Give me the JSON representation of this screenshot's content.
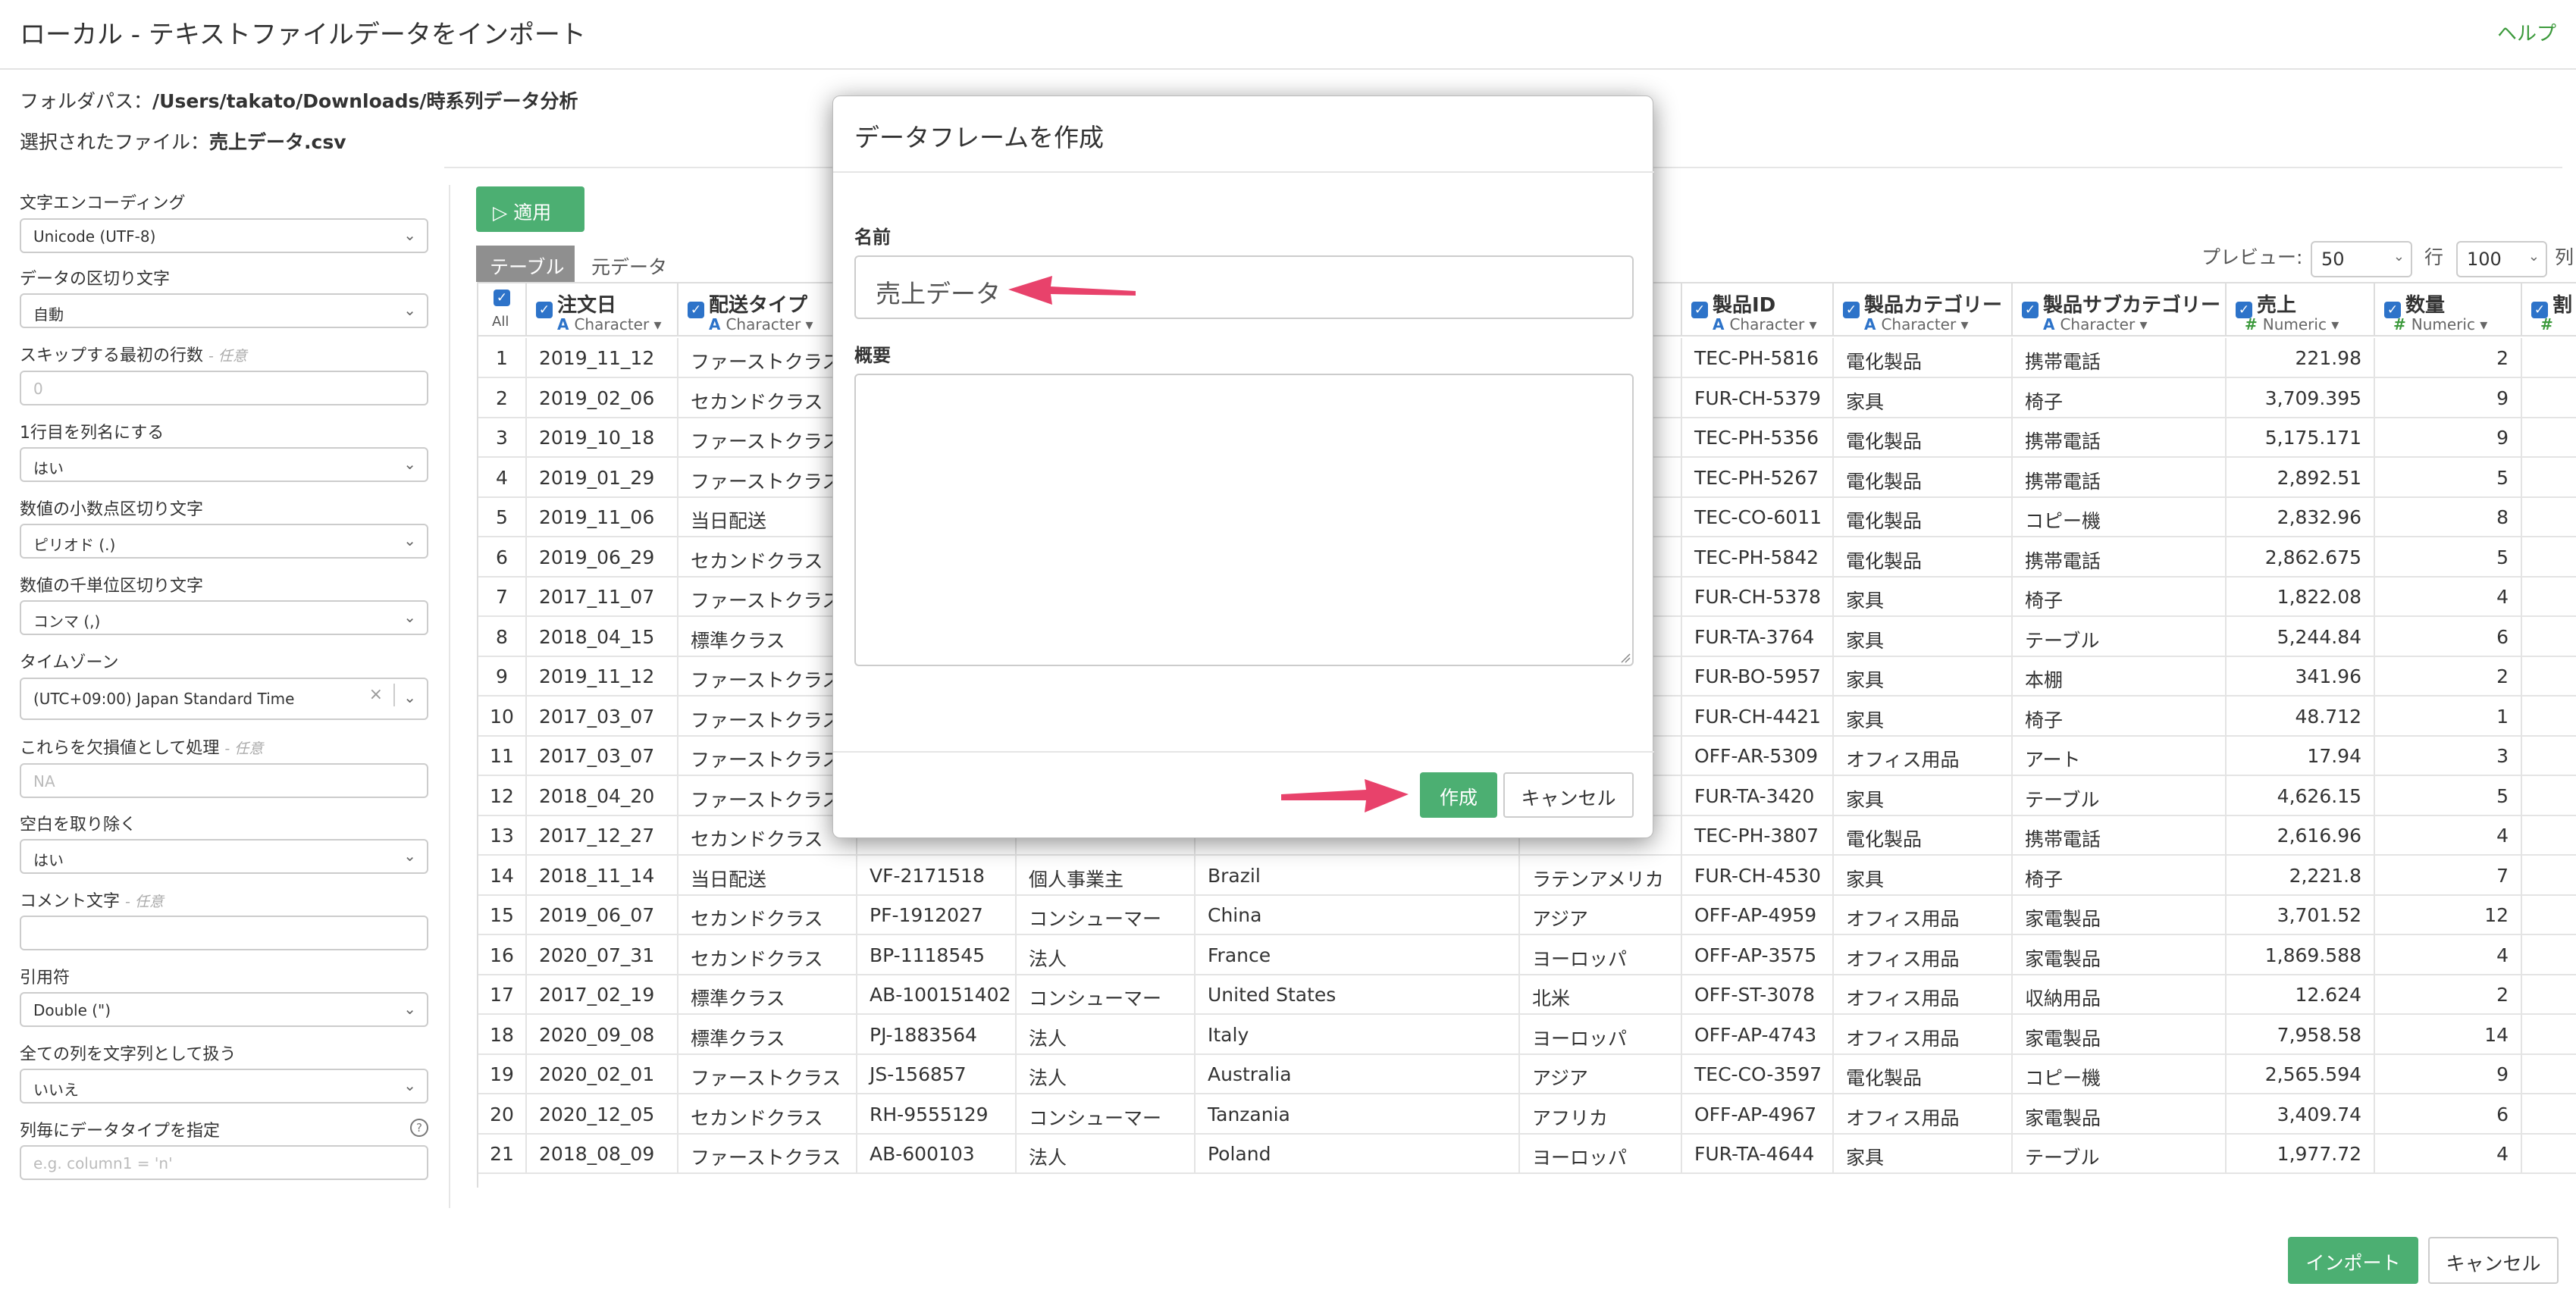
{
  "header": {
    "title": "ローカル - テキストファイルデータをインポート",
    "help": "ヘルプ"
  },
  "folder": {
    "label": "フォルダパス：",
    "value": "/Users/takato/Downloads/時系列データ分析"
  },
  "file": {
    "label": "選択されたファイル：",
    "value": "売上データ.csv"
  },
  "settings": {
    "encoding": {
      "label": "文字エンコーディング",
      "value": "Unicode (UTF-8)"
    },
    "delimiter": {
      "label": "データの区切り文字",
      "value": "自動"
    },
    "skip": {
      "label": "スキップする最初の行数",
      "optional": "- 任意",
      "placeholder": "0"
    },
    "header_row": {
      "label": "1行目を列名にする",
      "value": "はい"
    },
    "decimal": {
      "label": "数値の小数点区切り文字",
      "value": "ピリオド (.)"
    },
    "thousands": {
      "label": "数値の千単位区切り文字",
      "value": "コンマ (,)"
    },
    "timezone": {
      "label": "タイムゾーン",
      "value": "(UTC+09:00) Japan Standard Time",
      "clear": "×"
    },
    "na": {
      "label": "これらを欠損値として処理",
      "optional": "- 任意",
      "placeholder": "NA"
    },
    "trim": {
      "label": "空白を取り除く",
      "value": "はい"
    },
    "comment": {
      "label": "コメント文字",
      "optional": "- 任意",
      "placeholder": ""
    },
    "quote": {
      "label": "引用符",
      "value": "Double (\")"
    },
    "all_char": {
      "label": "全ての列を文字列として扱う",
      "value": "いいえ"
    },
    "col_types": {
      "label": "列毎にデータタイプを指定",
      "placeholder": "e.g. column1 = 'n'",
      "help": "?"
    }
  },
  "toolbar": {
    "apply": "適用",
    "tab_table": "テーブル",
    "tab_raw": "元データ",
    "preview_label": "プレビュー:",
    "preview_rows": "50",
    "row_label": "行",
    "cols_value": "100",
    "col_label": "列"
  },
  "table": {
    "all_label": "All",
    "columns": [
      {
        "name": "注文日",
        "type": "Character",
        "kind": "A"
      },
      {
        "name": "配送タイプ",
        "type": "Character",
        "kind": "A"
      },
      {
        "name": "",
        "type": "",
        "kind": ""
      },
      {
        "name": "",
        "type": "",
        "kind": ""
      },
      {
        "name": "",
        "type": "",
        "kind": ""
      },
      {
        "name": "",
        "type": "",
        "kind": ""
      },
      {
        "name": "製品ID",
        "type": "Character",
        "kind": "A"
      },
      {
        "name": "製品カテゴリー",
        "type": "Character",
        "kind": "A"
      },
      {
        "name": "製品サブカテゴリー",
        "type": "Character",
        "kind": "A"
      },
      {
        "name": "売上",
        "type": "Numeric",
        "kind": "#"
      },
      {
        "name": "数量",
        "type": "Numeric",
        "kind": "#"
      },
      {
        "name": "割",
        "type": "",
        "kind": "#"
      }
    ],
    "rows": [
      [
        "1",
        "2019_11_12",
        "ファーストクラス",
        "",
        "",
        "",
        "",
        "TEC-PH-5816",
        "電化製品",
        "携帯電話",
        "221.98",
        "2"
      ],
      [
        "2",
        "2019_02_06",
        "セカンドクラス",
        "",
        "",
        "",
        "",
        "FUR-CH-5379",
        "家具",
        "椅子",
        "3,709.395",
        "9"
      ],
      [
        "3",
        "2019_10_18",
        "ファーストクラス",
        "",
        "",
        "",
        "",
        "TEC-PH-5356",
        "電化製品",
        "携帯電話",
        "5,175.171",
        "9"
      ],
      [
        "4",
        "2019_01_29",
        "ファーストクラス",
        "",
        "",
        "",
        "",
        "TEC-PH-5267",
        "電化製品",
        "携帯電話",
        "2,892.51",
        "5"
      ],
      [
        "5",
        "2019_11_06",
        "当日配送",
        "",
        "",
        "",
        "",
        "TEC-CO-6011",
        "電化製品",
        "コピー機",
        "2,832.96",
        "8"
      ],
      [
        "6",
        "2019_06_29",
        "セカンドクラス",
        "",
        "",
        "",
        "",
        "TEC-PH-5842",
        "電化製品",
        "携帯電話",
        "2,862.675",
        "5"
      ],
      [
        "7",
        "2017_11_07",
        "ファーストクラス",
        "",
        "",
        "",
        "",
        "FUR-CH-5378",
        "家具",
        "椅子",
        "1,822.08",
        "4"
      ],
      [
        "8",
        "2018_04_15",
        "標準クラス",
        "",
        "",
        "",
        "",
        "FUR-TA-3764",
        "家具",
        "テーブル",
        "5,244.84",
        "6"
      ],
      [
        "9",
        "2019_11_12",
        "ファーストクラス",
        "",
        "",
        "",
        "",
        "FUR-BO-5957",
        "家具",
        "本棚",
        "341.96",
        "2"
      ],
      [
        "10",
        "2017_03_07",
        "ファーストクラス",
        "",
        "",
        "",
        "",
        "FUR-CH-4421",
        "家具",
        "椅子",
        "48.712",
        "1"
      ],
      [
        "11",
        "2017_03_07",
        "ファーストクラス",
        "",
        "",
        "",
        "",
        "OFF-AR-5309",
        "オフィス用品",
        "アート",
        "17.94",
        "3"
      ],
      [
        "12",
        "2018_04_20",
        "ファーストクラス",
        "",
        "",
        "",
        "",
        "FUR-TA-3420",
        "家具",
        "テーブル",
        "4,626.15",
        "5"
      ],
      [
        "13",
        "2017_12_27",
        "セカンドクラス",
        "",
        "",
        "",
        "",
        "TEC-PH-3807",
        "電化製品",
        "携帯電話",
        "2,616.96",
        "4"
      ],
      [
        "14",
        "2018_11_14",
        "当日配送",
        "VF-2171518",
        "個人事業主",
        "Brazil",
        "ラテンアメリカ",
        "FUR-CH-4530",
        "家具",
        "椅子",
        "2,221.8",
        "7"
      ],
      [
        "15",
        "2019_06_07",
        "セカンドクラス",
        "PF-1912027",
        "コンシューマー",
        "China",
        "アジア",
        "OFF-AP-4959",
        "オフィス用品",
        "家電製品",
        "3,701.52",
        "12"
      ],
      [
        "16",
        "2020_07_31",
        "セカンドクラス",
        "BP-1118545",
        "法人",
        "France",
        "ヨーロッパ",
        "OFF-AP-3575",
        "オフィス用品",
        "家電製品",
        "1,869.588",
        "4"
      ],
      [
        "17",
        "2017_02_19",
        "標準クラス",
        "AB-100151402",
        "コンシューマー",
        "United States",
        "北米",
        "OFF-ST-3078",
        "オフィス用品",
        "収納用品",
        "12.624",
        "2"
      ],
      [
        "18",
        "2020_09_08",
        "標準クラス",
        "PJ-1883564",
        "法人",
        "Italy",
        "ヨーロッパ",
        "OFF-AP-4743",
        "オフィス用品",
        "家電製品",
        "7,958.58",
        "14"
      ],
      [
        "19",
        "2020_02_01",
        "ファーストクラス",
        "JS-156857",
        "法人",
        "Australia",
        "アジア",
        "TEC-CO-3597",
        "電化製品",
        "コピー機",
        "2,565.594",
        "9"
      ],
      [
        "20",
        "2020_12_05",
        "セカンドクラス",
        "RH-9555129",
        "コンシューマー",
        "Tanzania",
        "アフリカ",
        "OFF-AP-4967",
        "オフィス用品",
        "家電製品",
        "3,409.74",
        "6"
      ],
      [
        "21",
        "2018_08_09",
        "ファーストクラス",
        "AB-600103",
        "法人",
        "Poland",
        "ヨーロッパ",
        "FUR-TA-4644",
        "家具",
        "テーブル",
        "1,977.72",
        "4"
      ]
    ]
  },
  "modal": {
    "title": "データフレームを作成",
    "name_label": "名前",
    "name_value": "売上データ",
    "desc_label": "概要",
    "create": "作成",
    "cancel": "キャンセル"
  },
  "footer": {
    "import": "インポート",
    "cancel": "キャンセル"
  },
  "colors": {
    "accent_green": "#4caf72",
    "arrow": "#e8426b",
    "type_blue": "#2d73c9"
  }
}
